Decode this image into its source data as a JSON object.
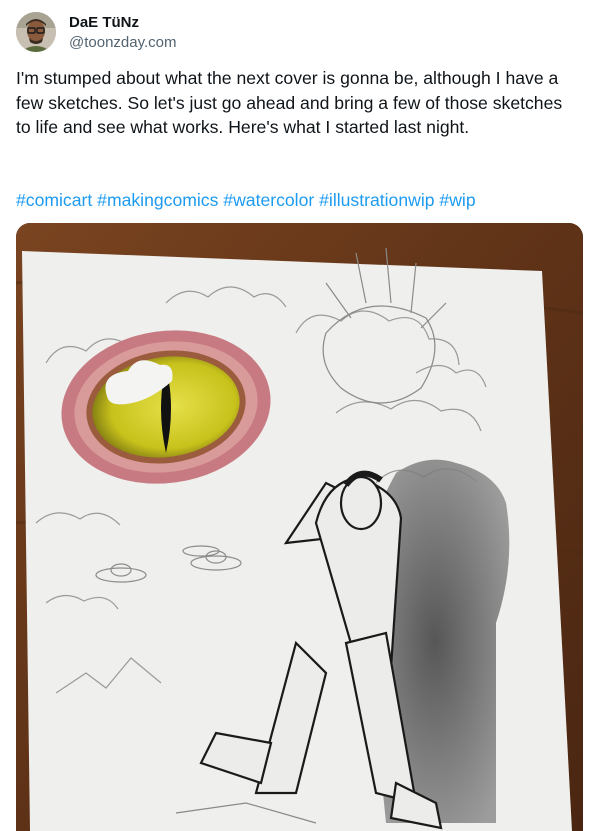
{
  "author": {
    "display_name": "DaE TüNz",
    "handle": "@toonzday.com",
    "avatar": "avatar-photo"
  },
  "post": {
    "text": "I'm stumped about what the next cover is gonna be, although I have a few sketches. So let's just go ahead and bring a few of those sketches to life and see what works. Here's what I started last night.",
    "hashtags": [
      "#comicart",
      "#makingcomics",
      "#watercolor",
      "#illustrationwip",
      "#wip"
    ],
    "media": "comic-cover-sketch-photo"
  },
  "colors": {
    "link": "#1d9bf0",
    "text": "#0f1419",
    "muted": "#536471"
  }
}
